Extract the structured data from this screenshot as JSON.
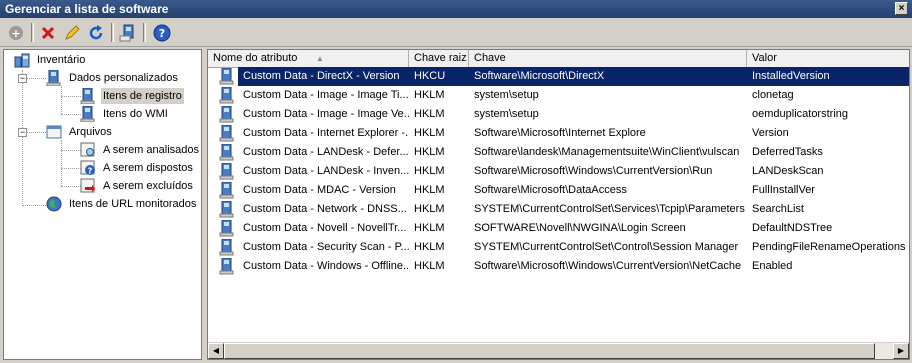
{
  "window": {
    "title": "Gerenciar a lista de software",
    "close_glyph": "×"
  },
  "toolbar": {
    "buttons": [
      {
        "name": "new-icon",
        "glyph": "+"
      },
      {
        "name": "delete-icon",
        "glyph": "✖"
      },
      {
        "name": "edit-icon",
        "glyph": "✎"
      },
      {
        "name": "refresh-icon",
        "glyph": "↻"
      },
      {
        "name": "scan-icon",
        "glyph": "▤"
      },
      {
        "name": "help-icon",
        "glyph": "?"
      }
    ]
  },
  "tree": {
    "inventory": "Inventário",
    "custom_data": "Dados personalizados",
    "registry_items": "Itens de registro",
    "wmi_items": "Itens do WMI",
    "files": "Arquivos",
    "to_scan": "A serem analisados",
    "to_dispose": "A serem dispostos",
    "to_exclude": "A serem excluídos",
    "url_items": "Itens de URL monitorados"
  },
  "list": {
    "columns": [
      "Nome do atributo",
      "Chave raiz",
      "Chave",
      "Valor"
    ],
    "sort_glyph": "▲",
    "rows": [
      {
        "name": "Custom Data - DirectX - Version",
        "root": "HKCU",
        "key": "Software\\Microsoft\\DirectX",
        "value": "InstalledVersion"
      },
      {
        "name": "Custom Data - Image - Image Ti...",
        "root": "HKLM",
        "key": "system\\setup",
        "value": "clonetag"
      },
      {
        "name": "Custom Data - Image - Image Ve...",
        "root": "HKLM",
        "key": "system\\setup",
        "value": "oemduplicatorstring"
      },
      {
        "name": "Custom Data - Internet Explorer -...",
        "root": "HKLM",
        "key": "Software\\Microsoft\\Internet Explore",
        "value": "Version"
      },
      {
        "name": "Custom Data - LANDesk - Defer...",
        "root": "HKLM",
        "key": "Software\\landesk\\Managementsuite\\WinClient\\vulscan",
        "value": "DeferredTasks"
      },
      {
        "name": "Custom Data - LANDesk - Inven...",
        "root": "HKLM",
        "key": "Software\\Microsoft\\Windows\\CurrentVersion\\Run",
        "value": "LANDeskScan"
      },
      {
        "name": "Custom Data - MDAC - Version",
        "root": "HKLM",
        "key": "Software\\Microsoft\\DataAccess",
        "value": "FullInstallVer"
      },
      {
        "name": "Custom Data - Network - DNSS...",
        "root": "HKLM",
        "key": "SYSTEM\\CurrentControlSet\\Services\\Tcpip\\Parameters",
        "value": "SearchList"
      },
      {
        "name": "Custom Data - Novell - NovellTr...",
        "root": "HKLM",
        "key": "SOFTWARE\\Novell\\NWGINA\\Login Screen",
        "value": "DefaultNDSTree"
      },
      {
        "name": "Custom Data - Security Scan - P...",
        "root": "HKLM",
        "key": "SYSTEM\\CurrentControlSet\\Control\\Session Manager",
        "value": "PendingFileRenameOperations"
      },
      {
        "name": "Custom Data - Windows - Offline...",
        "root": "HKLM",
        "key": "Software\\Microsoft\\Windows\\CurrentVersion\\NetCache",
        "value": "Enabled"
      }
    ]
  },
  "scrollbar": {
    "left_glyph": "◀",
    "right_glyph": "▶"
  },
  "colors": {
    "selection": "#0a246a",
    "title_bar": "#2c4a7c"
  }
}
